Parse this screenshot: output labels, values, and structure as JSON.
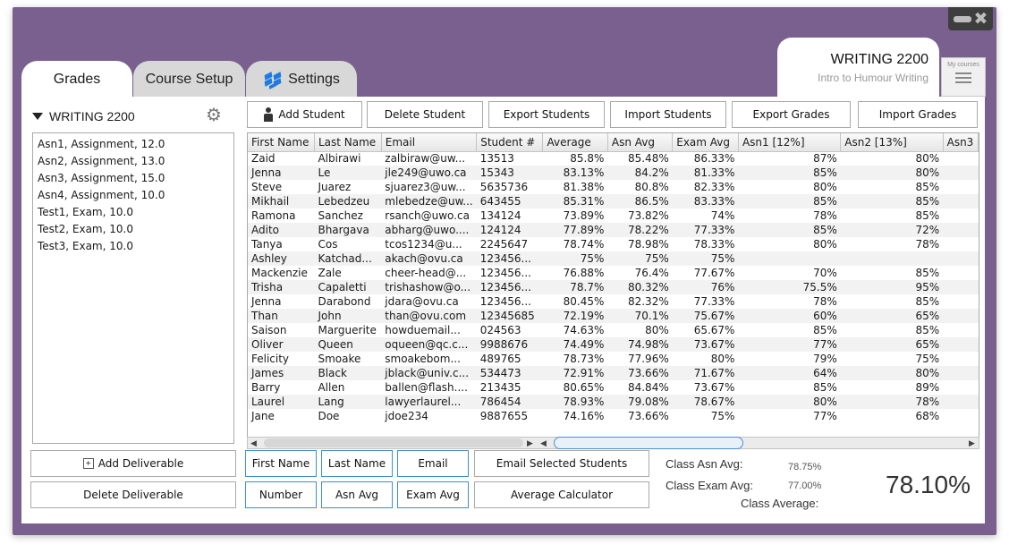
{
  "tabs": [
    {
      "label": "Grades"
    },
    {
      "label": "Course Setup"
    },
    {
      "label": "Settings"
    }
  ],
  "course_card": {
    "title": "WRITING 2200",
    "subtitle": "Intro to Humour Writing",
    "my_courses": "My courses"
  },
  "left_panel": {
    "course": "WRITING 2200",
    "deliverables": [
      "Asn1, Assignment, 12.0",
      "Asn2, Assignment, 13.0",
      "Asn3, Assignment, 15.0",
      "Asn4, Assignment, 10.0",
      "Test1, Exam, 10.0",
      "Test2, Exam, 10.0",
      "Test3, Exam, 10.0"
    ],
    "add_deliverable": "Add Deliverable",
    "delete_deliverable": "Delete Deliverable"
  },
  "toolbar": {
    "add_student": "Add Student",
    "delete_student": "Delete Student",
    "export_students": "Export Students",
    "import_students": "Import Students",
    "export_grades": "Export Grades",
    "import_grades": "Import Grades"
  },
  "table": {
    "columns": [
      "First Name",
      "Last Name",
      "Email",
      "Student #",
      "Average",
      "Asn Avg",
      "Exam Avg",
      "Asn1 [12%]",
      "Asn2 [13%]",
      "Asn3"
    ],
    "rows": [
      [
        "Zaid",
        "Albirawi",
        "zalbiraw@uw...",
        "13513",
        "85.8%",
        "85.48%",
        "86.33%",
        "87%",
        "80%",
        ""
      ],
      [
        "Jenna",
        "Le",
        "jle249@uwo.ca",
        "15343",
        "83.13%",
        "84.2%",
        "81.33%",
        "85%",
        "80%",
        ""
      ],
      [
        "Steve",
        "Juarez",
        "sjuarez3@uw...",
        "5635736",
        "81.38%",
        "80.8%",
        "82.33%",
        "80%",
        "85%",
        ""
      ],
      [
        "Mikhail",
        "Lebedzeu",
        "mlebedze@uw...",
        "643455",
        "85.31%",
        "86.5%",
        "83.33%",
        "85%",
        "85%",
        ""
      ],
      [
        "Ramona",
        "Sanchez",
        "rsanch@uwo.ca",
        "134124",
        "73.89%",
        "73.82%",
        "74%",
        "78%",
        "85%",
        ""
      ],
      [
        "Adito",
        "Bhargava",
        "abharg@uwo....",
        "124124",
        "77.89%",
        "78.22%",
        "77.33%",
        "85%",
        "72%",
        ""
      ],
      [
        "Tanya",
        "Cos",
        "tcos1234@u...",
        "2245647",
        "78.74%",
        "78.98%",
        "78.33%",
        "80%",
        "78%",
        ""
      ],
      [
        "Ashley",
        "Katchad...",
        "akach@ovu.ca",
        "123456...",
        "75%",
        "75%",
        "75%",
        "",
        "",
        ""
      ],
      [
        "Mackenzie",
        "Zale",
        "cheer-head@...",
        "123456...",
        "76.88%",
        "76.4%",
        "77.67%",
        "70%",
        "85%",
        ""
      ],
      [
        "Trisha",
        "Capaletti",
        "trishashow@o...",
        "123456...",
        "78.7%",
        "80.32%",
        "76%",
        "75.5%",
        "95%",
        ""
      ],
      [
        "Jenna",
        "Darabond",
        "jdara@ovu.ca",
        "123456...",
        "80.45%",
        "82.32%",
        "77.33%",
        "78%",
        "85%",
        ""
      ],
      [
        "Than",
        "John",
        "than@ovu.com",
        "12345685",
        "72.19%",
        "70.1%",
        "75.67%",
        "60%",
        "65%",
        ""
      ],
      [
        "Saison",
        "Marguerite",
        "howduemail...",
        "024563",
        "74.63%",
        "80%",
        "65.67%",
        "85%",
        "85%",
        ""
      ],
      [
        "Oliver",
        "Queen",
        "oqueen@qc.c...",
        "9988676",
        "74.49%",
        "74.98%",
        "73.67%",
        "77%",
        "65%",
        ""
      ],
      [
        "Felicity",
        "Smoake",
        "smoakebom...",
        "489765",
        "78.73%",
        "77.96%",
        "80%",
        "79%",
        "75%",
        ""
      ],
      [
        "James",
        "Black",
        "jblack@univ.c...",
        "534473",
        "72.91%",
        "73.66%",
        "71.67%",
        "64%",
        "80%",
        ""
      ],
      [
        "Barry",
        "Allen",
        "ballen@flash....",
        "213435",
        "80.65%",
        "84.84%",
        "73.67%",
        "85%",
        "89%",
        ""
      ],
      [
        "Laurel",
        "Lang",
        "lawyerlaurel...",
        "786454",
        "78.93%",
        "79.08%",
        "78.67%",
        "80%",
        "78%",
        ""
      ],
      [
        "Jane",
        "Doe",
        "jdoe234",
        "9887655",
        "74.16%",
        "73.66%",
        "75%",
        "77%",
        "68%",
        ""
      ]
    ]
  },
  "sort_buttons": {
    "first_name": "First Name",
    "last_name": "Last Name",
    "email": "Email",
    "number": "Number",
    "asn_avg": "Asn Avg",
    "exam_avg": "Exam Avg"
  },
  "actions": {
    "email_selected": "Email Selected Students",
    "average_calculator": "Average Calculator"
  },
  "stats": {
    "class_asn_avg_label": "Class Asn Avg:",
    "class_asn_avg": "78.75%",
    "class_exam_avg_label": "Class Exam Avg:",
    "class_exam_avg": "77.00%",
    "class_average_label": "Class Average:",
    "class_average": "78.10%"
  },
  "colors": {
    "frame": "#7a608e",
    "accent_border": "#3f8fc9"
  }
}
